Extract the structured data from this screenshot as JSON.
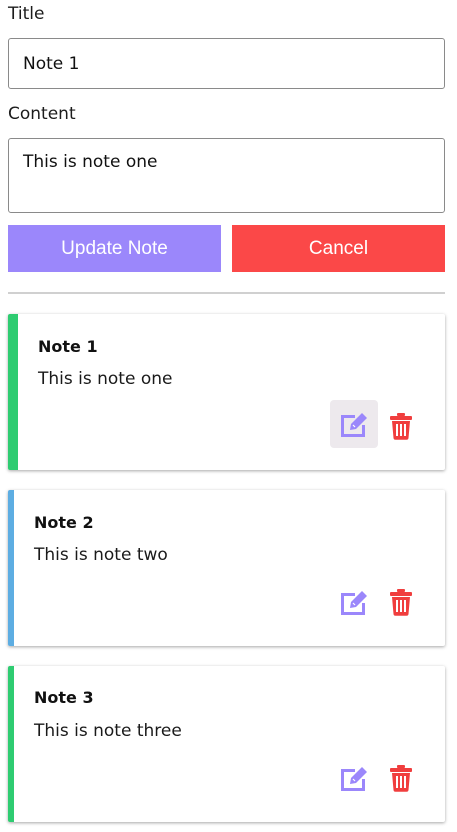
{
  "form": {
    "title_label": "Title",
    "title_value": "Note 1",
    "content_label": "Content",
    "content_value": "This is note one",
    "update_button_label": "Update Note",
    "cancel_button_label": "Cancel"
  },
  "notes": [
    {
      "title": "Note 1",
      "content": "This is note one",
      "accent_color": "#2ecc71",
      "edit_icon": "edit-icon",
      "delete_icon": "trash-icon",
      "edit_hovered": true
    },
    {
      "title": "Note 2",
      "content": "This is note two",
      "accent_color": "#5dade2",
      "edit_icon": "edit-icon",
      "delete_icon": "trash-icon",
      "edit_hovered": false
    },
    {
      "title": "Note 3",
      "content": "This is note three",
      "accent_color": "#2ecc71",
      "edit_icon": "edit-icon",
      "delete_icon": "trash-icon",
      "edit_hovered": false
    }
  ],
  "colors": {
    "update_button": "#9b87fb",
    "cancel_button": "#fb4848",
    "edit_icon": "#9b87fb",
    "delete_icon": "#f03e3e"
  }
}
